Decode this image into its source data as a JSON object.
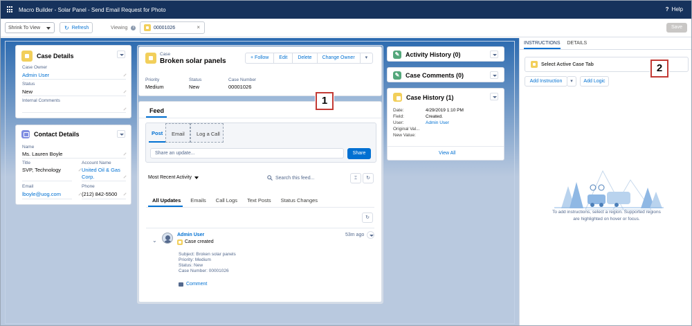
{
  "titlebar": {
    "title": "Macro Builder - Solar Panel - Send Email Request for Photo",
    "help_label": "Help"
  },
  "toolbar": {
    "shrink_select": "Shrink To View",
    "refresh_label": "Refresh",
    "viewing_label": "Viewing",
    "viewing_tab": "00001026",
    "save_label": "Save"
  },
  "case_details": {
    "title": "Case Details",
    "fields": [
      {
        "label": "Case Owner",
        "value": "Admin User"
      },
      {
        "label": "Status",
        "value": "New"
      },
      {
        "label": "Internal Comments",
        "value": ""
      }
    ]
  },
  "contact_details": {
    "title": "Contact Details",
    "name_label": "Name",
    "name": "Ms. Lauren Boyle",
    "title_label": "Title",
    "title_value": "SVP, Technology",
    "account_label": "Account Name",
    "account_line1": "United Oil & Gas",
    "account_line2": "Corp.",
    "email_label": "Email",
    "email": "lboyle@uog.com",
    "phone_label": "Phone",
    "phone": "(212) 842-5500"
  },
  "case_header": {
    "object_label": "Case",
    "title": "Broken solar panels",
    "buttons": {
      "follow": "Follow",
      "edit": "Edit",
      "delete": "Delete",
      "change_owner": "Change Owner"
    },
    "priority_label": "Priority",
    "priority": "Medium",
    "status_label": "Status",
    "status": "New",
    "case_number_label": "Case Number",
    "case_number": "00001026"
  },
  "feed": {
    "title": "Feed",
    "publisher_tabs": {
      "post": "Post",
      "email": "Email",
      "log_call": "Log a Call"
    },
    "share_placeholder": "Share an update...",
    "share_button": "Share",
    "sort_label": "Most Recent Activity",
    "search_placeholder": "Search this feed...",
    "filter_tabs": {
      "all": "All Updates",
      "emails": "Emails",
      "call_logs": "Call Logs",
      "text_posts": "Text Posts",
      "status_changes": "Status Changes"
    },
    "item": {
      "author": "Admin User",
      "action": "Case created",
      "time": "53m ago",
      "subject": "Subject: Broken solar panels",
      "priority": "Priority: Medium",
      "status": "Status: New",
      "case_number": "Case Number: 00001026",
      "comment_label": "Comment"
    }
  },
  "activity_history": {
    "title": "Activity History (0)"
  },
  "case_comments": {
    "title": "Case Comments (0)"
  },
  "case_history": {
    "title": "Case History (1)",
    "date_label": "Date:",
    "date": "4/29/2019 1:10 PM",
    "field_label": "Field:",
    "field": "Created.",
    "user_label": "User:",
    "user": "Admin User",
    "original_label": "Original Val...",
    "new_label": "New Value:",
    "view_all": "View All"
  },
  "right_panel": {
    "tabs": {
      "instructions": "INSTRUCTIONS",
      "details": "DETAILS"
    },
    "select_tab": "Select Active Case Tab",
    "add_instruction": "Add Instruction",
    "add_logic": "Add Logic",
    "empty_line1": "To add instructions, select a region. Supported regions",
    "empty_line2": "are highlighted on hover or focus."
  },
  "badges": {
    "one": "1",
    "two": "2"
  },
  "colors": {
    "navy": "#16325c",
    "link": "#0070d2",
    "case_yellow": "#f2cf5b",
    "contact_purple": "#7f8de1",
    "teal_icon": "#54a77b",
    "badge_red": "#c23934"
  },
  "icons": [
    "app-grid-icon",
    "help-icon",
    "refresh-icon",
    "info-icon",
    "case-icon",
    "contact-icon",
    "wrench-icon",
    "pencil-icon",
    "chevron-down-icon",
    "search-icon",
    "filter-icon",
    "avatar",
    "comment-icon",
    "illustration-trees-camper"
  ]
}
